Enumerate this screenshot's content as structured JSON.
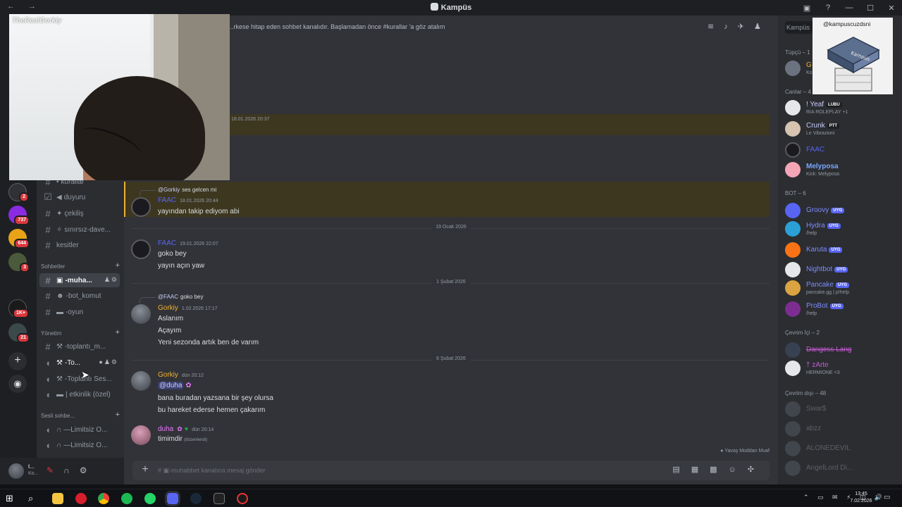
{
  "window": {
    "title": "Kampüs",
    "nav": "← →",
    "controls": [
      "▣",
      "?",
      "—",
      "☐",
      "✕"
    ]
  },
  "colors": {
    "accent": "#5865f2",
    "gold": "#f0b232",
    "danger": "#da373c",
    "online": "#23a55a"
  },
  "webcam": {
    "watermark": "TheRealGorkiy"
  },
  "logo_overlay": {
    "handle": "@kampuscuzdsni",
    "sign": "Kampüs"
  },
  "servers": [
    {
      "badge": "2"
    },
    {
      "badge": "737"
    },
    {
      "badge": "644"
    },
    {
      "badge": "3"
    },
    {
      "badge": "1K+"
    },
    {
      "badge": "21"
    }
  ],
  "sidebar": {
    "channels_top": [
      {
        "icon": "pin",
        "label": "kurallar"
      },
      {
        "icon": "megaphone",
        "label": "duyuru"
      },
      {
        "icon": "party",
        "label": "çekiliş"
      },
      {
        "icon": "sparkle",
        "label": "sınırsız-dave..."
      },
      {
        "icon": "none",
        "label": "kesitler"
      }
    ],
    "cat_sohbetler": "Sohbetler",
    "channels_sohbet": [
      {
        "label": "-muha...",
        "active": true
      },
      {
        "label": "-bot_komut"
      },
      {
        "label": "-oyun"
      }
    ],
    "cat_yonetim": "Yönetim",
    "channels_yonetim": [
      {
        "type": "text",
        "label": "-toplantı_m..."
      },
      {
        "type": "voice",
        "label": "-To..."
      },
      {
        "type": "voice",
        "label": "-Toplantı Ses..."
      },
      {
        "type": "voice",
        "label": "| etkinlik (özel)"
      }
    ],
    "cat_sesli": "Sesli sohbe...",
    "channels_sesli": [
      {
        "label": "—Limitsiz O..."
      },
      {
        "label": "—Limitsiz O..."
      }
    ],
    "user": {
      "name": "t...",
      "status": "Ko..."
    }
  },
  "chat": {
    "topic": "...rkese hitap eden sohbet kanalıdır. Başlamadan önce #kurallar 'a göz atalım",
    "search_placeholder": "Kampüs",
    "first_timestamp": "18.01.2026 20:37",
    "messages": [
      {
        "reply_to": "@Gorkiy",
        "reply_text": "ses gelcen mi",
        "author": "FAAC",
        "author_color": "#5865f2",
        "time": "18.01.2026 20:44",
        "lines": [
          "yayından takip ediyom abi"
        ],
        "highlight": true
      },
      {
        "date": "19 Ocak 2026"
      },
      {
        "author": "FAAC",
        "author_color": "#5865f2",
        "time": "19.01.2026 22:07",
        "lines": [
          "goko bey",
          "yayın açın yaw"
        ]
      },
      {
        "date": "1 Şubat 2026"
      },
      {
        "reply_to": "@FAAC",
        "reply_text": "goko bey",
        "author": "Gorkiy",
        "author_color": "#f0b232",
        "time": "1.02.2026 17:17",
        "lines": [
          "Aslanım",
          "Açayım",
          "Yeni sezonda artık ben de varım"
        ]
      },
      {
        "date": "6 Şubat 2026"
      },
      {
        "author": "Gorkiy",
        "author_color": "#f0b232",
        "time": "dün 20:12",
        "mention": "@duha",
        "lines": [
          "bana buradan yazsana bir şey olursa",
          "bu hareket ederse hemen çakarım"
        ]
      },
      {
        "author": "duha",
        "author_color": "#e879f9",
        "time": "dün 20:14",
        "lines": [
          "timimdir"
        ],
        "edited": "(düzenlendi)"
      }
    ],
    "slowmode": "Yavaş Moddan Muaf",
    "composer_placeholder": "-muhabbet kanalına mesaj gönder"
  },
  "members": {
    "groups": [
      {
        "title": "Tüpçü – 1"
      },
      {
        "title": "Canlar – 4"
      },
      {
        "title": "BOT – 6"
      },
      {
        "title": "Çevrim İçi – 2"
      },
      {
        "title": "Çevrim dışı – 48"
      }
    ],
    "tupcu": [
      {
        "name": "G",
        "sub": "Ko"
      }
    ],
    "canlar": [
      {
        "name": "! Yeaf",
        "tag": "LUBU",
        "sub": "RIA ROLEPLAY +1",
        "color": "#c9cdfb"
      },
      {
        "name": "Crunk",
        "tag": "PTT",
        "sub": "Le Vibrazioni",
        "color": "#c9cdfb"
      },
      {
        "name": "FAAC",
        "sub": "",
        "color": "#5865f2"
      },
      {
        "name": "Melyposa",
        "sub": "Kick: Melyposa",
        "color": "#7aa7ff"
      }
    ],
    "bots": [
      {
        "name": "Groovy",
        "tag": "UYG",
        "sub": "",
        "color": "#7f8cff"
      },
      {
        "name": "Hydra",
        "tag": "UYG",
        "sub": "/help",
        "color": "#7f8cff"
      },
      {
        "name": "Karuta",
        "tag": "UYG",
        "sub": "",
        "color": "#7f8cff"
      },
      {
        "name": "Nightbot",
        "tag": "UYG",
        "sub": "",
        "color": "#7f8cff"
      },
      {
        "name": "Pancake",
        "tag": "UYG",
        "sub": "pancake.gg | p!help",
        "color": "#7f8cff"
      },
      {
        "name": "ProBot",
        "tag": "UYG",
        "sub": "/help",
        "color": "#7f8cff"
      }
    ],
    "online": [
      {
        "name": "Dangess Lang",
        "sub": "",
        "color": "#c75ad6"
      },
      {
        "name": "† zArte",
        "sub": "HERMIONE <3",
        "color": "#c75ad6"
      }
    ],
    "offline": [
      {
        "name": "Swar$"
      },
      {
        "name": "abzz"
      },
      {
        "name": "ALONEDEVIL"
      },
      {
        "name": "AngelLord Di..."
      }
    ]
  },
  "taskbar": {
    "time": "13:45",
    "date": "7.02.2026",
    "tray": "⌃ ▭ ✉ ⚡ ◫ 🔊"
  }
}
